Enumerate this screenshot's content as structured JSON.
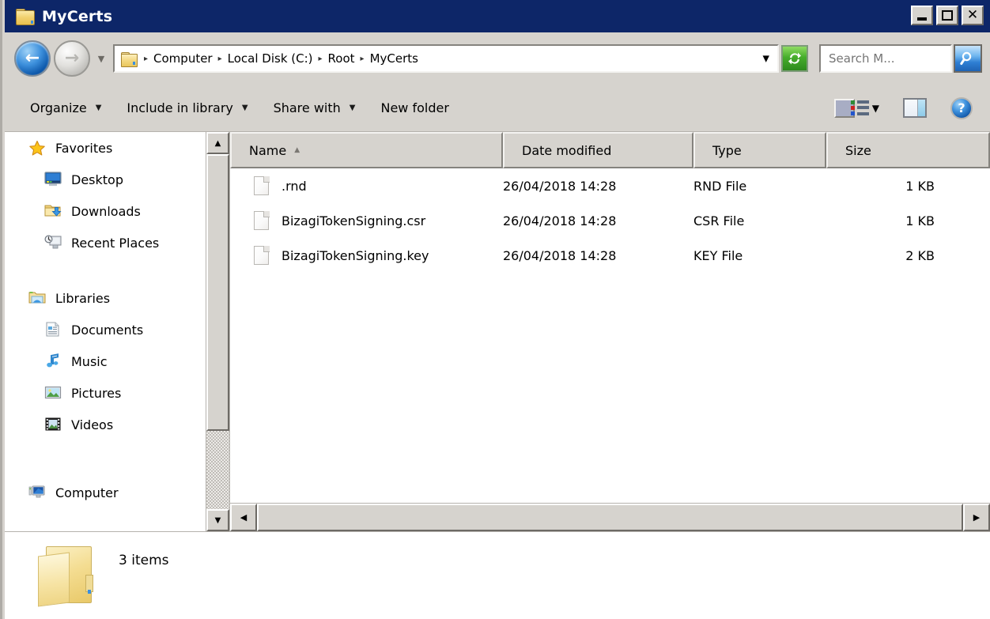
{
  "window": {
    "title": "MyCerts",
    "title_icon": "folder-icon",
    "controls": {
      "minimize": "minimize-button",
      "maximize": "maximize-button",
      "close_glyph": "✕"
    }
  },
  "address_bar": {
    "back_label": "Back",
    "forward_label": "Forward",
    "recent_label": "Recent pages",
    "folder_icon": "folder-icon",
    "breadcrumbs": [
      "Computer",
      "Local Disk (C:)",
      "Root",
      "MyCerts"
    ],
    "separator": "▸",
    "dropdown_caret": "▼",
    "refresh_label": "Refresh"
  },
  "search": {
    "value": "",
    "placeholder": "Search M...",
    "button_label": "Search"
  },
  "toolbar": {
    "items": [
      {
        "label": "Organize",
        "has_caret": true
      },
      {
        "label": "Include in library",
        "has_caret": true
      },
      {
        "label": "Share with",
        "has_caret": true
      },
      {
        "label": "New folder",
        "has_caret": false
      }
    ],
    "caret": "▼",
    "view_icon": "view-options-icon",
    "view_caret": "▼",
    "preview_icon": "preview-pane-icon",
    "help_icon": "help-icon",
    "help_glyph": "?"
  },
  "sidebar": {
    "groups": [
      {
        "header": {
          "label": "Favorites",
          "icon": "star-icon"
        },
        "items": [
          {
            "label": "Desktop",
            "icon": "desktop-icon"
          },
          {
            "label": "Downloads",
            "icon": "downloads-icon"
          },
          {
            "label": "Recent Places",
            "icon": "recent-places-icon"
          }
        ]
      },
      {
        "header": {
          "label": "Libraries",
          "icon": "libraries-icon"
        },
        "items": [
          {
            "label": "Documents",
            "icon": "documents-icon"
          },
          {
            "label": "Music",
            "icon": "music-icon"
          },
          {
            "label": "Pictures",
            "icon": "pictures-icon"
          },
          {
            "label": "Videos",
            "icon": "videos-icon"
          }
        ]
      },
      {
        "header": {
          "label": "Computer",
          "icon": "computer-icon"
        },
        "items": []
      }
    ],
    "scroll_up": "▲",
    "scroll_down": "▼"
  },
  "file_list": {
    "columns": [
      {
        "label": "Name",
        "sorted": true,
        "sort_arrow": "▲"
      },
      {
        "label": "Date modified",
        "sorted": false
      },
      {
        "label": "Type",
        "sorted": false
      },
      {
        "label": "Size",
        "sorted": false
      }
    ],
    "rows": [
      {
        "name": ".rnd",
        "date": "26/04/2018 14:28",
        "type": "RND File",
        "size": "1 KB",
        "icon": "file-icon"
      },
      {
        "name": "BizagiTokenSigning.csr",
        "date": "26/04/2018 14:28",
        "type": "CSR File",
        "size": "1 KB",
        "icon": "file-icon"
      },
      {
        "name": "BizagiTokenSigning.key",
        "date": "26/04/2018 14:28",
        "type": "KEY File",
        "size": "2 KB",
        "icon": "file-icon"
      }
    ],
    "scroll_left": "◀",
    "scroll_right": "▶"
  },
  "status_bar": {
    "icon": "open-folder-icon",
    "text": "3 items"
  },
  "colors": {
    "titlebar": "#0d2668",
    "chrome": "#d6d3ce",
    "pane": "#ffffff",
    "refresh_green": "#46ad2c",
    "search_blue": "#2f7fd4"
  }
}
